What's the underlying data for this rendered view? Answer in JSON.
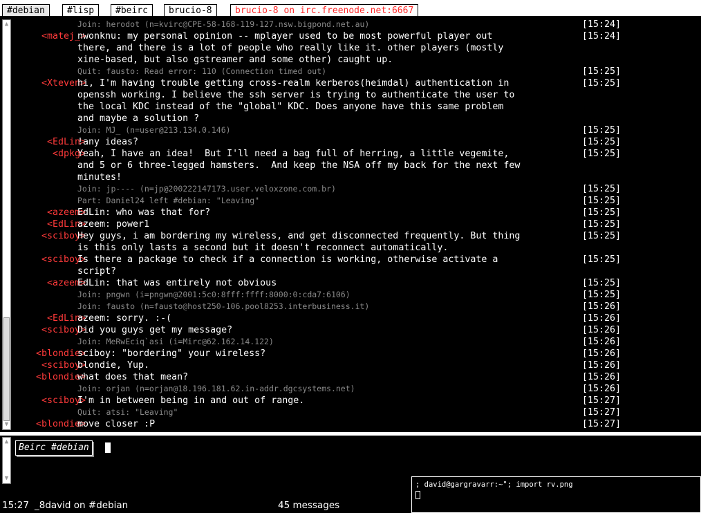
{
  "tabs": [
    {
      "label": "#debian",
      "alert": false,
      "active": true
    },
    {
      "label": "#lisp",
      "alert": false,
      "active": false
    },
    {
      "label": "#beirc",
      "alert": false,
      "active": false
    },
    {
      "label": "brucio-8",
      "alert": false,
      "active": false
    },
    {
      "label": "brucio-8 on irc.freenode.net:6667",
      "alert": true,
      "active": false
    }
  ],
  "messages": [
    {
      "nick": "",
      "text": "Join: herodot (n=kvirc@CPE-58-168-119-127.nsw.bigpond.net.au)",
      "time": "[15:24]",
      "sys": true
    },
    {
      "nick": "<matej_>",
      "text": "nwonknu: my personal opinion -- mplayer used to be most powerful player out",
      "time": "[15:24]",
      "sys": false
    },
    {
      "nick": "",
      "text": "there, and there is a lot of people who really like it. other players (mostly",
      "time": "",
      "sys": false
    },
    {
      "nick": "",
      "text": "xine-based, but also gstreamer and some other) caught up.",
      "time": "",
      "sys": false
    },
    {
      "nick": "",
      "text": "Quit: fausto: Read error: 110 (Connection timed out)",
      "time": "[15:25]",
      "sys": true
    },
    {
      "nick": "<Xteven>",
      "text": "hi, I'm having trouble getting cross-realm kerberos(heimdal) authentication in",
      "time": "[15:25]",
      "sys": false
    },
    {
      "nick": "",
      "text": "openssh working. I believe the ssh server is trying to authenticate the user to",
      "time": "",
      "sys": false
    },
    {
      "nick": "",
      "text": "the local KDC instead of the \"global\" KDC. Does anyone have this same problem",
      "time": "",
      "sys": false
    },
    {
      "nick": "",
      "text": "and maybe a solution ?",
      "time": "",
      "sys": false
    },
    {
      "nick": "",
      "text": "Join: MJ_ (n=user@213.134.0.146)",
      "time": "[15:25]",
      "sys": true
    },
    {
      "nick": "<EdLin>",
      "text": "!any ideas?",
      "time": "[15:25]",
      "sys": false
    },
    {
      "nick": "<dpkg>",
      "text": "Yeah, I have an idea!  But I'll need a bag full of herring, a little vegemite,",
      "time": "[15:25]",
      "sys": false
    },
    {
      "nick": "",
      "text": "and 5 or 6 three-legged hamsters.  And keep the NSA off my back for the next few",
      "time": "",
      "sys": false
    },
    {
      "nick": "",
      "text": "minutes!",
      "time": "",
      "sys": false
    },
    {
      "nick": "",
      "text": "Join: jp---- (n=jp@200222147173.user.veloxzone.com.br)",
      "time": "[15:25]",
      "sys": true
    },
    {
      "nick": "",
      "text": "Part: Daniel24 left #debian: \"Leaving\"",
      "time": "[15:25]",
      "sys": true
    },
    {
      "nick": "<azeem>",
      "text": "EdLin: who was that for?",
      "time": "[15:25]",
      "sys": false
    },
    {
      "nick": "<EdLin>",
      "text": "azeem: power1",
      "time": "[15:25]",
      "sys": false
    },
    {
      "nick": "<sciboy>",
      "text": "Hey guys, i am bordering my wireless, and get disconnected frequently. But thing",
      "time": "[15:25]",
      "sys": false
    },
    {
      "nick": "",
      "text": "is this only lasts a second but it doesn't reconnect automatically.",
      "time": "",
      "sys": false
    },
    {
      "nick": "<sciboy>",
      "text": "Is there a package to check if a connection is working, otherwise activate a",
      "time": "[15:25]",
      "sys": false
    },
    {
      "nick": "",
      "text": "script?",
      "time": "",
      "sys": false
    },
    {
      "nick": "<azeem>",
      "text": "EdLin: that was entirely not obvious",
      "time": "[15:25]",
      "sys": false
    },
    {
      "nick": "",
      "text": "Join: pngwn (i=pngwn@2001:5c0:8fff:ffff:8000:0:cda7:6106)",
      "time": "[15:25]",
      "sys": true
    },
    {
      "nick": "",
      "text": "Join: fausto (n=fausto@host250-106.pool8253.interbusiness.it)",
      "time": "[15:26]",
      "sys": true
    },
    {
      "nick": "<EdLin>",
      "text": "azeem: sorry. :-(",
      "time": "[15:26]",
      "sys": false
    },
    {
      "nick": "<sciboy>",
      "text": "Did you guys get my message?",
      "time": "[15:26]",
      "sys": false
    },
    {
      "nick": "",
      "text": "Join: MeRwEciq`asi (i=Mirc@62.162.14.122)",
      "time": "[15:26]",
      "sys": true
    },
    {
      "nick": "<blondie>",
      "text": "sciboy: \"bordering\" your wireless?",
      "time": "[15:26]",
      "sys": false
    },
    {
      "nick": "<sciboy>",
      "text": "blondie, Yup.",
      "time": "[15:26]",
      "sys": false
    },
    {
      "nick": "<blondie>",
      "text": "what does that mean?",
      "time": "[15:26]",
      "sys": false
    },
    {
      "nick": "",
      "text": "Join: orjan (n=orjan@18.196.181.62.in-addr.dgcsystems.net)",
      "time": "[15:26]",
      "sys": true
    },
    {
      "nick": "<sciboy>",
      "text": "I'm in between being in and out of range.",
      "time": "[15:27]",
      "sys": false
    },
    {
      "nick": "",
      "text": "Quit: atsi: \"Leaving\"",
      "time": "[15:27]",
      "sys": true
    },
    {
      "nick": "<blondie>",
      "text": "move closer :P",
      "time": "[15:27]",
      "sys": false
    }
  ],
  "input": {
    "prompt": "Beirc #debian",
    "value": ""
  },
  "status": {
    "time": "15:27",
    "user": "_8david on #debian",
    "count": "45 messages"
  },
  "xterm": {
    "line": "; david@gargravarr:~\"; import rv.png"
  },
  "colors": {
    "nick": "#ff3a3a",
    "alert_tab": "#ff2a2a",
    "system_text": "#8a8a8a"
  }
}
